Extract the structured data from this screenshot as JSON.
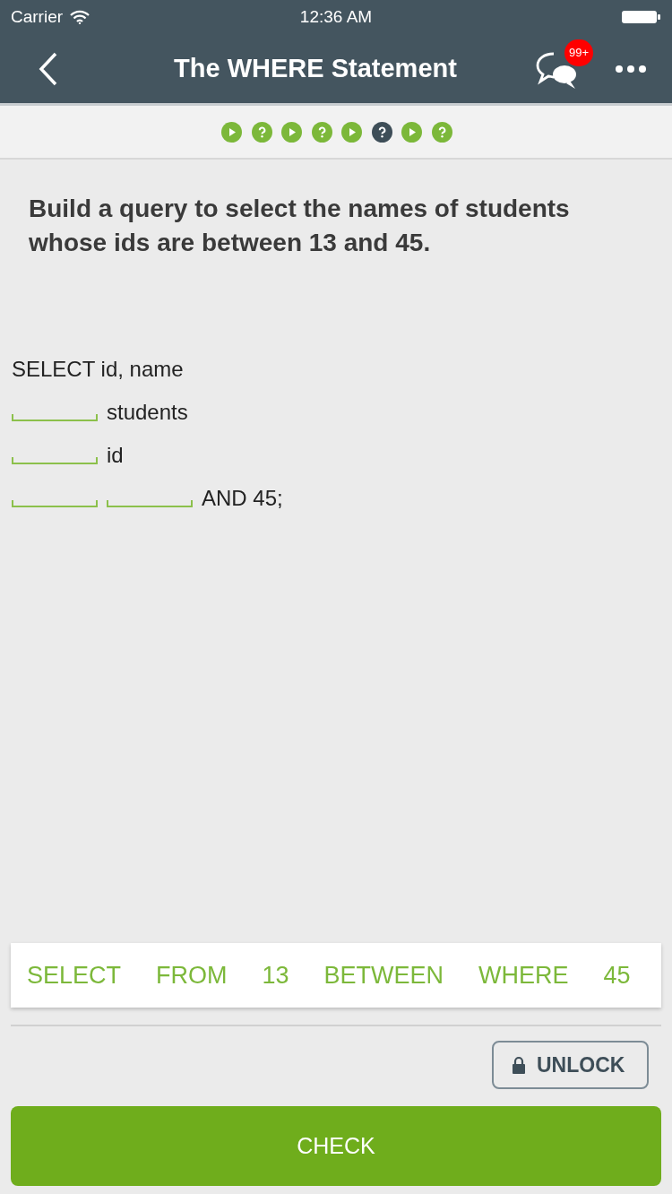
{
  "status_bar": {
    "carrier": "Carrier",
    "time": "12:36 AM"
  },
  "nav": {
    "title": "The WHERE Statement",
    "badge": "99+"
  },
  "progress": [
    {
      "kind": "play",
      "selected": false
    },
    {
      "kind": "question",
      "selected": false
    },
    {
      "kind": "play",
      "selected": false
    },
    {
      "kind": "question",
      "selected": false
    },
    {
      "kind": "play",
      "selected": false
    },
    {
      "kind": "question",
      "selected": true
    },
    {
      "kind": "play",
      "selected": false
    },
    {
      "kind": "question",
      "selected": false
    }
  ],
  "question": "Build a query to select the names of students whose ids are between 13 and 45.",
  "code_lines": [
    [
      {
        "kind": "text",
        "text": "SELECT id, name"
      }
    ],
    [
      {
        "kind": "blank"
      },
      {
        "kind": "text",
        "text": "students"
      }
    ],
    [
      {
        "kind": "blank"
      },
      {
        "kind": "text",
        "text": "id"
      }
    ],
    [
      {
        "kind": "blank"
      },
      {
        "kind": "blank"
      },
      {
        "kind": "text",
        "text": "AND 45;"
      }
    ]
  ],
  "word_bank": [
    "SELECT",
    "FROM",
    "13",
    "BETWEEN",
    "WHERE",
    "45"
  ],
  "unlock_button": "UNLOCK",
  "check_button": "CHECK"
}
